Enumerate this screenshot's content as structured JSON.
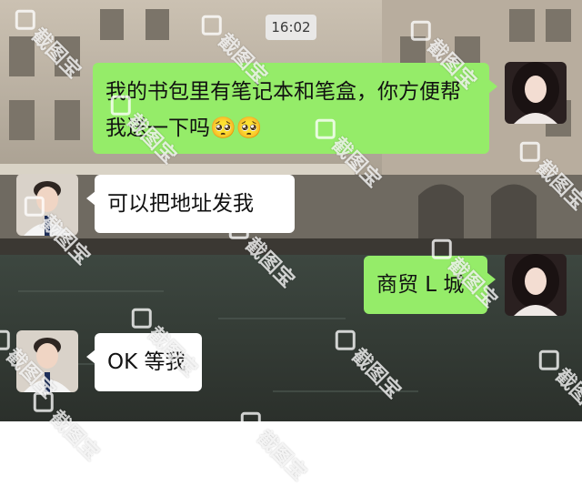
{
  "chat": {
    "timestamp": "16:02",
    "messages": [
      {
        "side": "right",
        "text": "我的书包里有笔记本和笔盒，你方便帮我送一下吗🥺🥺"
      },
      {
        "side": "left",
        "text": "可以把地址发我"
      },
      {
        "side": "right",
        "text": "商贸 L 城"
      },
      {
        "side": "left",
        "text": "OK 等我"
      }
    ]
  },
  "watermark": {
    "text": "截图宝"
  },
  "colors": {
    "sent_bubble": "#95ec69",
    "received_bubble": "#ffffff"
  }
}
